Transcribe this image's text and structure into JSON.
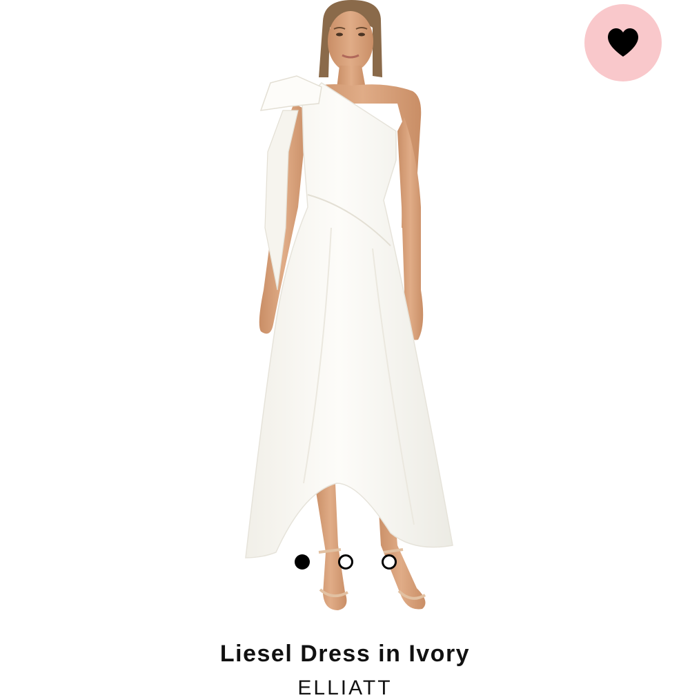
{
  "colors": {
    "wishlist_bg": "#f9c8cb",
    "heart": "#000000",
    "dress": "#fbfaf6",
    "skin": "#d7a07a"
  },
  "wishlist": {
    "icon": "heart-icon",
    "active": true
  },
  "carousel": {
    "slides": 3,
    "active_index": 0
  },
  "product": {
    "title": "Liesel Dress in Ivory",
    "brand": "ELLIATT"
  }
}
